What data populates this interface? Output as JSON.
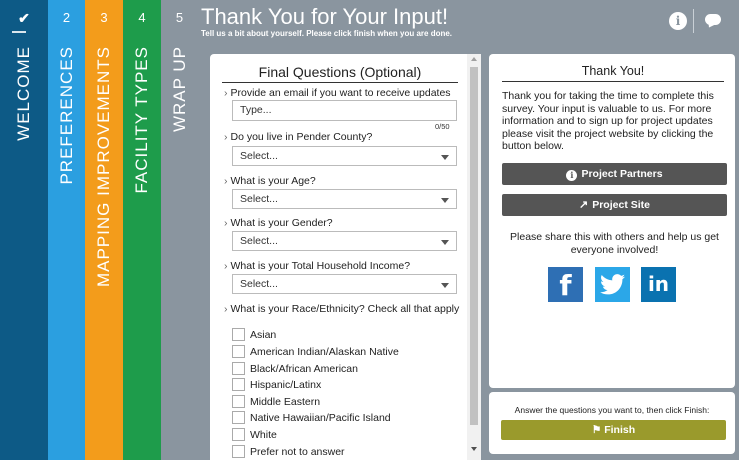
{
  "steps": [
    {
      "number": "✔",
      "label": "WELCOME"
    },
    {
      "number": "2",
      "label": "PREFERENCES"
    },
    {
      "number": "3",
      "label": "MAPPING IMPROVEMENTS"
    },
    {
      "number": "4",
      "label": "FACILITY TYPES"
    },
    {
      "number": "5",
      "label": "WRAP UP"
    }
  ],
  "header": {
    "title": "Thank You for Your Input!",
    "subtitle": "Tell us a bit about yourself. Please click finish when you are done."
  },
  "form": {
    "title": "Final Questions (Optional)",
    "email_question": "Provide an email if you want to receive updates",
    "email_placeholder": "Type...",
    "email_counter": "0/50",
    "county_question": "Do you live in Pender County?",
    "age_question": "What is your Age?",
    "gender_question": "What is your Gender?",
    "income_question": "What is your Total Household Income?",
    "select_value": "Select...",
    "race_question": "What is your Race/Ethnicity? Check all that apply",
    "race_options": [
      "Asian",
      "American Indian/Alaskan Native",
      "Black/African American",
      "Hispanic/Latinx",
      "Middle Eastern",
      "Native Hawaiian/Pacific Island",
      "White",
      "Prefer not to answer"
    ]
  },
  "thanks": {
    "title": "Thank You!",
    "message": "Thank you for taking the time to complete this survey. Your input is valuable to us. For more information and to sign up for project updates please visit the project website by clicking the button below.",
    "partners_label": "Project Partners",
    "site_label": "Project Site",
    "share_text": "Please share this with others and help us get everyone involved!"
  },
  "social": {
    "facebook": "f",
    "linkedin": "in"
  },
  "finish": {
    "instruction": "Answer the questions you want to, then click Finish:",
    "label": "Finish"
  },
  "icons": [
    "check-icon",
    "info-icon",
    "chat-icon",
    "caret-down-icon",
    "external-link-icon",
    "flag-icon",
    "facebook-icon",
    "twitter-icon",
    "linkedin-icon"
  ],
  "colors": {
    "welcome": "#0d5a86",
    "preferences": "#2b9fe0",
    "mapping": "#f39c1b",
    "facility": "#1e9c4b",
    "wrapup": "#8a959f",
    "finish": "#9a9a2c"
  }
}
